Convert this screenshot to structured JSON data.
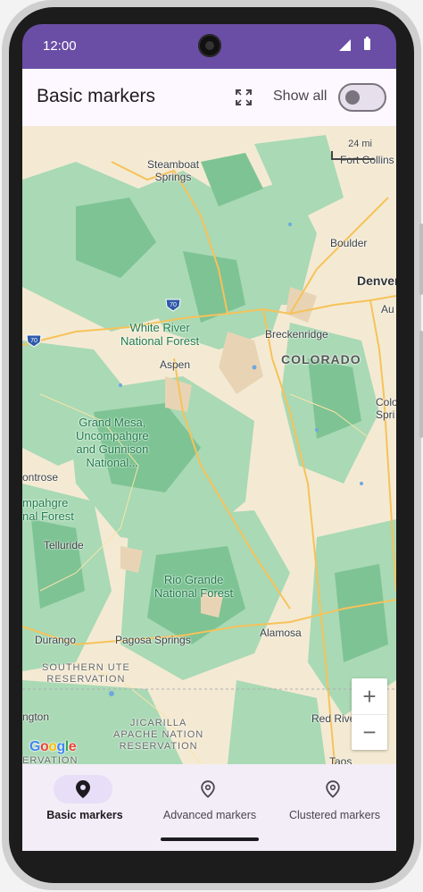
{
  "status_bar": {
    "time": "12:00"
  },
  "app_bar": {
    "title": "Basic markers",
    "toggle_label": "Show all",
    "toggle_on": false
  },
  "map": {
    "labels": {
      "steamboat": "Steamboat\nSprings",
      "fort_collins": "Fort Collins",
      "boulder": "Boulder",
      "denver": "Denver",
      "aurora": "Au",
      "white_river": "White River\nNational Forest",
      "breckenridge": "Breckenridge",
      "colorado": "COLORADO",
      "aspen": "Aspen",
      "colorado_springs": "Colo\nSpri",
      "grand_mesa": "Grand Mesa,\nUncompahgre\nand Gunnison\nNational...",
      "montrose": "ontrose",
      "uncompahgre": "mpahgre\nnal Forest",
      "telluride": "Telluride",
      "rio_grande": "Rio Grande\nNational Forest",
      "alamosa": "Alamosa",
      "durango": "Durango",
      "pagosa": "Pagosa Springs",
      "southern_ute": "SOUTHERN UTE\nRESERVATION",
      "farmington": "ngton",
      "red_river": "Red River",
      "jicarilla": "JICARILLA\nAPACHE NATION\nRESERVATION",
      "taos": "Taos",
      "reservation_edge": "ERVATION"
    },
    "highways": {
      "i70_east": "70",
      "i70_west": "70"
    },
    "scale_label": "24 mi",
    "zoom_in": "+",
    "zoom_out": "−",
    "logo": [
      "G",
      "o",
      "o",
      "g",
      "l",
      "e"
    ]
  },
  "bottom_nav": [
    {
      "label": "Basic markers",
      "icon": "place-filled-icon",
      "active": true
    },
    {
      "label": "Advanced markers",
      "icon": "place-outline-icon",
      "active": false
    },
    {
      "label": "Clustered markers",
      "icon": "place-outline-icon",
      "active": false
    }
  ]
}
